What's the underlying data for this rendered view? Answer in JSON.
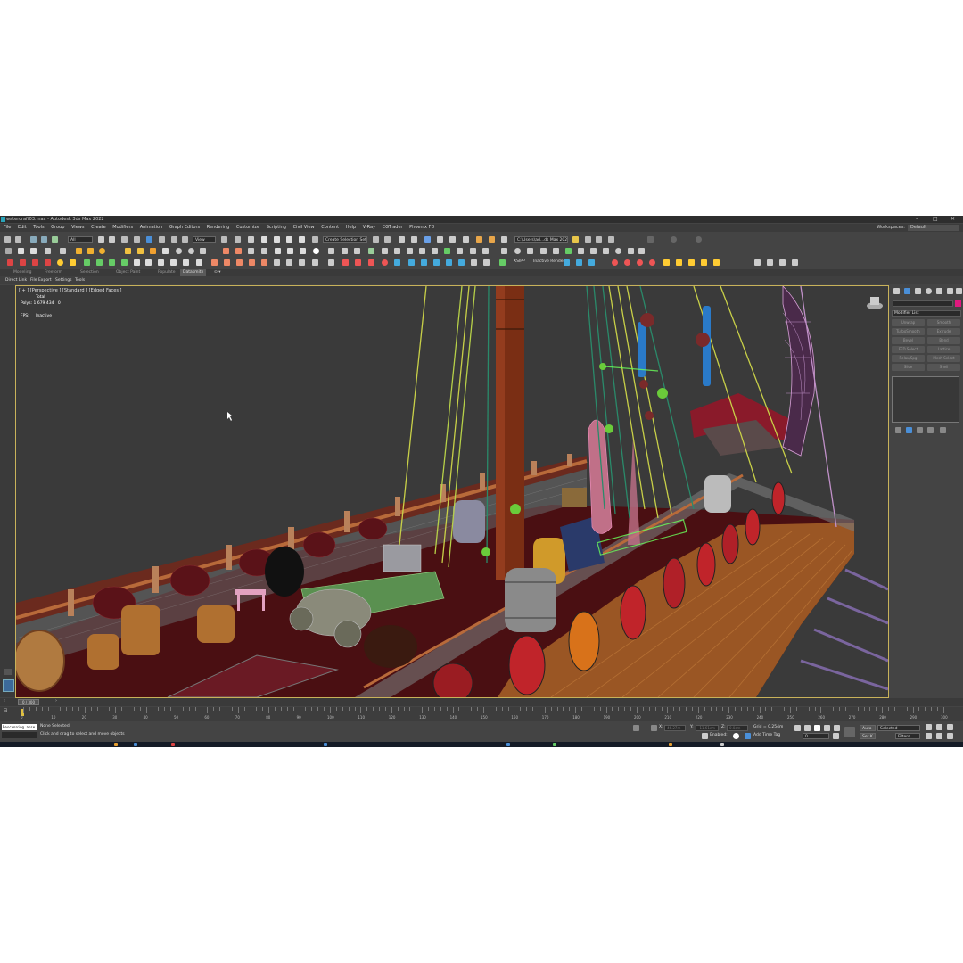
{
  "window": {
    "title": "watercraft03.max - Autodesk 3ds Max 2022",
    "controls": [
      "–",
      "□",
      "✕"
    ]
  },
  "menu": {
    "items": [
      "File",
      "Edit",
      "Tools",
      "Group",
      "Views",
      "Create",
      "Modifiers",
      "Animation",
      "Graph Editors",
      "Rendering",
      "Customize",
      "Scripting",
      "Civil View",
      "Content",
      "Help",
      "V-Ray",
      "CGTrader",
      "Phoenix FD"
    ],
    "workspaces_label": "Workspaces:",
    "workspace_value": "Default"
  },
  "toolbar": {
    "filter_value": "All",
    "view_value": "View",
    "selection_set_placeholder": "Create Selection Set",
    "project_path": "C:\\Users\\ad...ds Max 2022",
    "render_label_a": "XSIPP",
    "render_label_b": "Inactive Render"
  },
  "ribbon": {
    "tabs": [
      "Modeling",
      "Freeform",
      "Selection",
      "Object Paint",
      "Populate",
      "Datasmith"
    ],
    "active_tab": "Datasmith",
    "subitems": [
      "Direct Link",
      "File Export",
      "Settings",
      "Tools"
    ]
  },
  "viewport": {
    "label": "[ + ] [Perspective ] [Standard ] [Edged Faces ]",
    "stats_total_label": "Total",
    "polys_label": "Polys:",
    "polys_value": "1 679 434",
    "polys_selected": "0",
    "fps_label": "FPS:",
    "fps_value": "Inactive"
  },
  "command_panel": {
    "modifier_list": "Modifier List",
    "swatch_color": "#e0197e",
    "modifier_buttons": [
      "Unwrap",
      "Smooth",
      "TurboSmooth",
      "Extrude",
      "Bevel",
      "Bend",
      "FFD Select",
      "Lattice",
      "Relax/Spg",
      "Mesh Select",
      "Slice",
      "Shell"
    ]
  },
  "timeline": {
    "frame": "0 / 300",
    "ticks": [
      "0",
      "10",
      "20",
      "30",
      "40",
      "50",
      "60",
      "70",
      "80",
      "90",
      "100",
      "110",
      "120",
      "130",
      "140",
      "150",
      "160",
      "170",
      "180",
      "190",
      "200",
      "210",
      "220",
      "230",
      "240",
      "250",
      "260",
      "270",
      "280",
      "290",
      "300"
    ]
  },
  "status": {
    "maxscript": "Rescanning asse",
    "selection": "None Selected",
    "prompt": "Click and drag to select and move objects",
    "x_label": "X:",
    "x_value": "46.27m",
    "y_label": "Y:",
    "y_value": "-11.61cm",
    "z_label": "Z:",
    "z_value": "0.0cm",
    "grid": "Grid = 0.254m",
    "enabled": "Enabled:",
    "add_time_tag": "Add Time Tag",
    "auto": "Auto",
    "set_k": "Set K.",
    "key_mode": "Selected",
    "filters": "Filters...",
    "frame_field": "0"
  }
}
